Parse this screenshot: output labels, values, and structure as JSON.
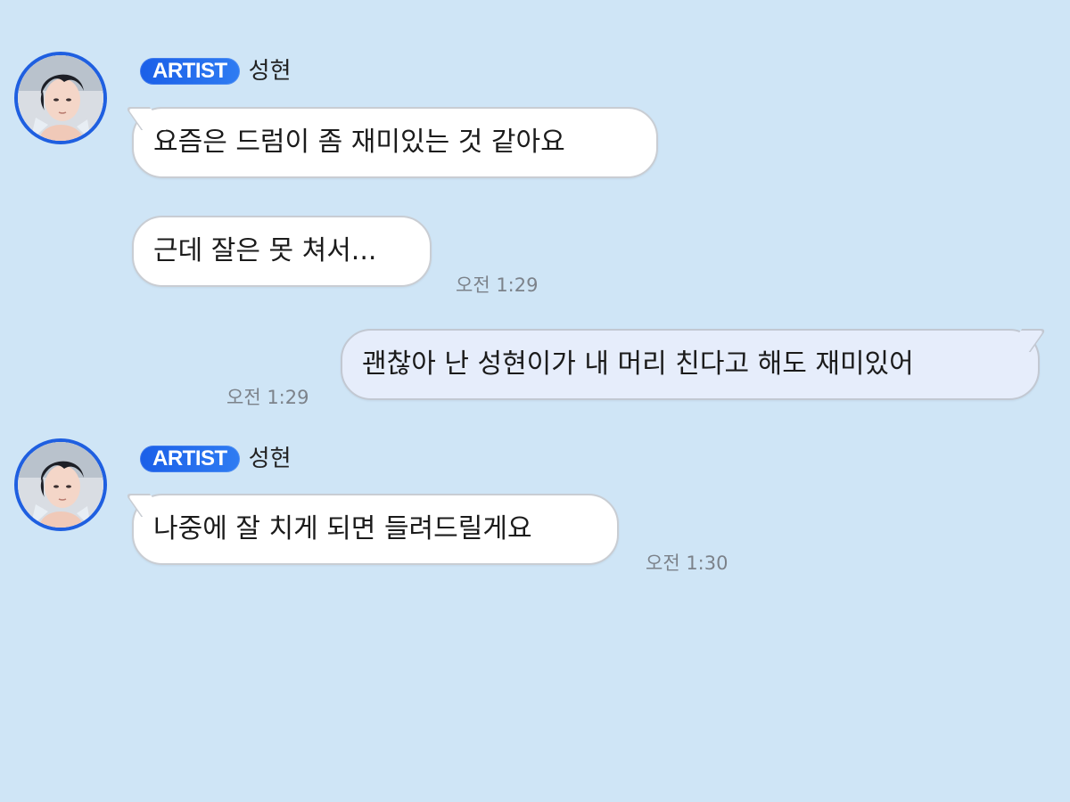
{
  "chat": {
    "messages": [
      {
        "sender": {
          "badge": "ARTIST",
          "name": "성현"
        },
        "bubbles": [
          {
            "text": "요즘은 드럼이 좀 재미있는 것 같아요"
          },
          {
            "text": "근데 잘은 못 쳐서..."
          }
        ],
        "time": "오전 1:29"
      },
      {
        "outgoing": true,
        "bubbles": [
          {
            "text": "괜찮아 난 성현이가 내 머리 친다고 해도 재미있어"
          }
        ],
        "time": "오전 1:29"
      },
      {
        "sender": {
          "badge": "ARTIST",
          "name": "성현"
        },
        "bubbles": [
          {
            "text": "나중에 잘 치게 되면 들려드릴게요"
          }
        ],
        "time": "오전 1:30"
      }
    ]
  },
  "colors": {
    "background": "#cfe5f6",
    "badge": "#1f5fe0",
    "avatar_ring": "#1f5fe0",
    "incoming_bubble": "#ffffff",
    "outgoing_bubble": "#e6edfb",
    "timestamp": "#7c828a"
  },
  "icons": {
    "avatar": "artist-profile-avatar"
  }
}
